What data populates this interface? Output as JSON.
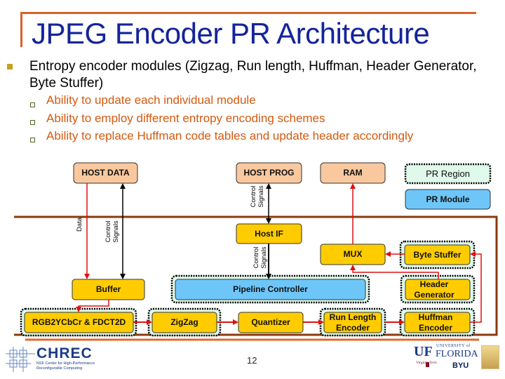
{
  "slide": {
    "title": "JPEG Encoder PR Architecture",
    "main_bullet": "Entropy encoder modules (Zigzag, Run length, Huffman, Header Generator, Byte Stuffer)",
    "sub_bullets": [
      "Ability to update each individual module",
      "Ability to employ different entropy encoding schemes",
      "Ability to replace Huffman code tables and update header accordingly"
    ],
    "page_number": "12"
  },
  "colors": {
    "title": "#14249a",
    "accent_orange": "#d9622b",
    "sub_bullet_text": "#d45a10",
    "host_block": "#f9c89e",
    "module_block": "#ffcc00",
    "pr_module_block": "#6ec6f8",
    "pr_region_fill": "#dff9ea",
    "data_arrow": "#dd1111",
    "control_arrow": "#000000",
    "fpga_border": "#8b3a10"
  },
  "diagram": {
    "host_blocks": {
      "host_data": "HOST DATA",
      "host_prog": "HOST PROG",
      "ram": "RAM"
    },
    "legend": {
      "pr_region": "PR Region",
      "pr_module": "PR Module"
    },
    "modules": {
      "host_if": "Host IF",
      "mux": "MUX",
      "byte_stuffer": "Byte Stuffer",
      "buffer": "Buffer",
      "pipeline_controller": "Pipeline Controller",
      "header_generator": "Header Generator",
      "rgb2ycbcr": "RGB2YCbCr & FDCT2D",
      "zigzag": "ZigZag",
      "quantizer": "Quantizer",
      "run_length_encoder": "Run Length Encoder",
      "huffman_encoder": "Huffman Encoder"
    },
    "signal_labels": {
      "data": "Data",
      "control_signals_host_data": "Control Signals",
      "control_signals_host_prog": "Control Signals",
      "control_signals_host_if": "Control Signals"
    }
  },
  "logos": {
    "chrec": "CHREC",
    "chrec_subtitle": "NSF Center for High-Performance Reconfigurable Computing",
    "uf": "UF",
    "uf_university": "UNIVERSITY of",
    "uf_florida": "FLORIDA",
    "virginia_tech": "Virginia Tech",
    "byu": "BYU"
  }
}
